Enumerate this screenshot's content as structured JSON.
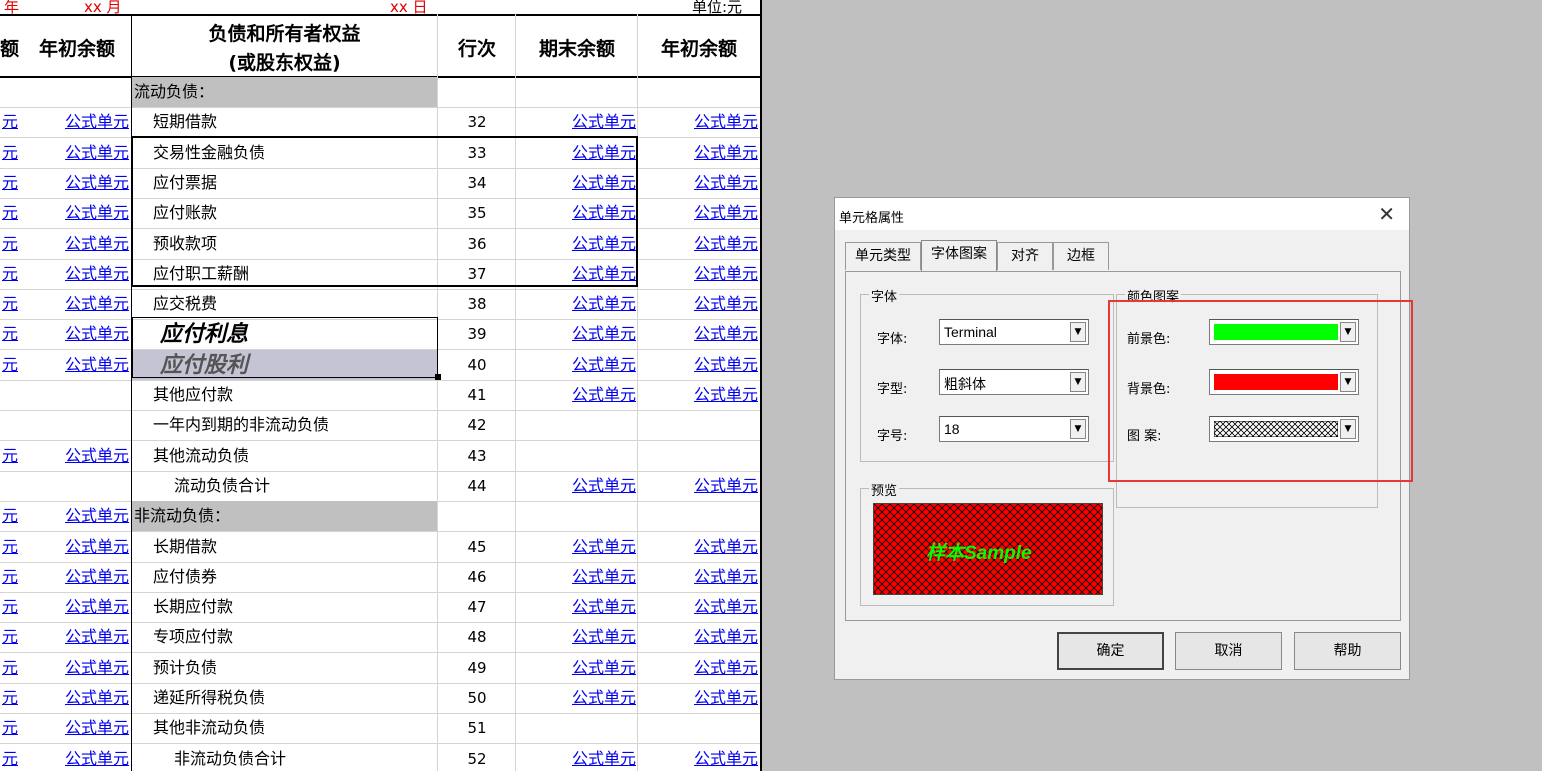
{
  "header": {
    "year": "年",
    "month": "xx  月",
    "day": "xx  日",
    "unit": "单位:元",
    "col_amount_partial": "额",
    "col_begin_left": "年初余额",
    "col_liab_line1": "负债和所有者权益",
    "col_liab_line2": "(或股东权益)",
    "col_row": "行次",
    "col_end": "期末余额",
    "col_begin_right": "年初余额"
  },
  "formula_text": "公式单元",
  "formula_partial": "元",
  "rows": [
    {
      "label": "流动负债：",
      "section": true,
      "left_formula": false,
      "right_formula": false
    },
    {
      "label": "短期借款",
      "num": "32",
      "left_formula": true,
      "right_formula": true
    },
    {
      "label": "交易性金融负债",
      "num": "33",
      "left_formula": true,
      "right_formula": true
    },
    {
      "label": "应付票据",
      "num": "34",
      "left_formula": true,
      "right_formula": true
    },
    {
      "label": "应付账款",
      "num": "35",
      "left_formula": true,
      "right_formula": true
    },
    {
      "label": "预收款项",
      "num": "36",
      "left_formula": true,
      "right_formula": true
    },
    {
      "label": "应付职工薪酬",
      "num": "37",
      "left_formula": true,
      "right_formula": true
    },
    {
      "label": "应交税费",
      "num": "38",
      "left_formula": true,
      "right_formula": true
    },
    {
      "label": "应付利息",
      "num": "39",
      "left_formula": true,
      "right_formula": true,
      "style": "big"
    },
    {
      "label": "应付股利",
      "num": "40",
      "left_formula": true,
      "right_formula": true,
      "style": "big-gray"
    },
    {
      "label": "其他应付款",
      "num": "41",
      "left_formula": false,
      "right_formula": true
    },
    {
      "label": "一年内到期的非流动负债",
      "num": "42",
      "left_formula": false,
      "right_formula": false
    },
    {
      "label": "其他流动负债",
      "num": "43",
      "left_formula": true,
      "right_formula": false
    },
    {
      "label": "流动负债合计",
      "num": "44",
      "left_formula": false,
      "right_formula": true,
      "indent": true
    },
    {
      "label": "非流动负债：",
      "section": true,
      "left_formula": true,
      "right_formula": false
    },
    {
      "label": "长期借款",
      "num": "45",
      "left_formula": true,
      "right_formula": true
    },
    {
      "label": "应付债券",
      "num": "46",
      "left_formula": true,
      "right_formula": true
    },
    {
      "label": "长期应付款",
      "num": "47",
      "left_formula": true,
      "right_formula": true
    },
    {
      "label": "专项应付款",
      "num": "48",
      "left_formula": true,
      "right_formula": true
    },
    {
      "label": "预计负债",
      "num": "49",
      "left_formula": true,
      "right_formula": true
    },
    {
      "label": "递延所得税负债",
      "num": "50",
      "left_formula": true,
      "right_formula": true
    },
    {
      "label": "其他非流动负债",
      "num": "51",
      "left_formula": true,
      "right_formula": false
    },
    {
      "label": "非流动负债合计",
      "num": "52",
      "left_formula": true,
      "right_formula": true,
      "indent": true
    }
  ],
  "dialog": {
    "title": "单元格属性",
    "close": "✕",
    "tabs": [
      "单元类型",
      "字体图案",
      "对齐",
      "边框"
    ],
    "active_tab": 1,
    "font_group": "字体",
    "font_label": "字体:",
    "font_value": "Terminal",
    "style_label": "字型:",
    "style_value": "粗斜体",
    "size_label": "字号:",
    "size_value": "18",
    "color_group": "颜色图案",
    "fg_label": "前景色:",
    "fg_color": "#00ff00",
    "bg_label": "背景色:",
    "bg_color": "#ff0000",
    "pattern_label": "图  案:",
    "preview_group": "预览",
    "preview_text": "样本Sample",
    "ok": "确定",
    "cancel": "取消",
    "help": "帮助",
    "highlight_color": "#e53935"
  }
}
